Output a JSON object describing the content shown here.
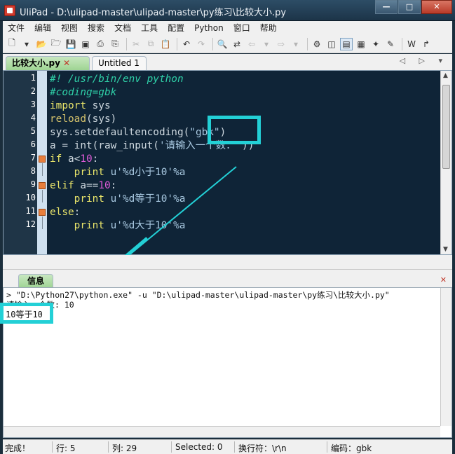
{
  "window": {
    "title": "UliPad - D:\\ulipad-master\\ulipad-master\\py练习\\比较大小.py",
    "min": "—",
    "max": "□",
    "close": "✕"
  },
  "menu": [
    "文件",
    "编辑",
    "视图",
    "搜索",
    "文档",
    "工具",
    "配置",
    "Python",
    "窗口",
    "帮助"
  ],
  "tabs": [
    {
      "label": "比较大小.py",
      "close": "✕"
    },
    {
      "label": "Untitled 1"
    }
  ],
  "tab_nav": "◁ ▷ ▾",
  "editor": {
    "line_numbers": [
      "1",
      "2",
      "3",
      "4",
      "5",
      "6",
      "7",
      "8",
      "9",
      "10",
      "11",
      "12"
    ],
    "code": [
      [
        {
          "t": "#! /usr/bin/env python",
          "c": "com"
        }
      ],
      [
        {
          "t": "#coding=gbk",
          "c": "com"
        }
      ],
      [
        {
          "t": "import",
          "c": "kw"
        },
        {
          "t": " sys",
          "c": "txt"
        }
      ],
      [
        {
          "t": "reload",
          "c": "fn"
        },
        {
          "t": "(sys)",
          "c": "txt"
        }
      ],
      [
        {
          "t": "sys.setdefaultencoding(",
          "c": "txt"
        },
        {
          "t": "\"gbk\"",
          "c": "str"
        },
        {
          "t": ")",
          "c": "txt"
        }
      ],
      [
        {
          "t": "a = int(raw_input(",
          "c": "txt"
        },
        {
          "t": "'请输入一个数：'",
          "c": "str"
        },
        {
          "t": "))",
          "c": "txt"
        }
      ],
      [
        {
          "t": "if",
          "c": "kw"
        },
        {
          "t": " a<",
          "c": "txt"
        },
        {
          "t": "10",
          "c": "num"
        },
        {
          "t": ":",
          "c": "txt"
        }
      ],
      [
        {
          "t": "    print",
          "c": "kw"
        },
        {
          "t": " u'%d小于10'%a",
          "c": "str"
        }
      ],
      [
        {
          "t": "elif",
          "c": "kw"
        },
        {
          "t": " a==",
          "c": "txt"
        },
        {
          "t": "10",
          "c": "num"
        },
        {
          "t": ":",
          "c": "txt"
        }
      ],
      [
        {
          "t": "    print",
          "c": "kw"
        },
        {
          "t": " u'%d等于10'%a",
          "c": "str"
        }
      ],
      [
        {
          "t": "else",
          "c": "kw"
        },
        {
          "t": ":",
          "c": "txt"
        }
      ],
      [
        {
          "t": "    print",
          "c": "kw"
        },
        {
          "t": " u'%d大于10'%a",
          "c": "str"
        }
      ]
    ],
    "highlight_text": "\"gbk\""
  },
  "info_panel": {
    "tab": "信息",
    "close": "✕",
    "lines": [
      "> \"D:\\Python27\\python.exe\" -u \"D:\\ulipad-master\\ulipad-master\\py练习\\比较大小.py\"",
      "请输入一个数: 10"
    ],
    "result": "10等于10"
  },
  "status": {
    "state": "完成！",
    "row": "行: 5",
    "col": "列: 29",
    "selected": "Selected: 0",
    "newline": "换行符：\\r\\n",
    "encoding": "编码：gbk"
  },
  "colors": {
    "highlight": "#23d0d6",
    "editor_bg": "#0f2437",
    "tab_active": "#9fd493"
  }
}
